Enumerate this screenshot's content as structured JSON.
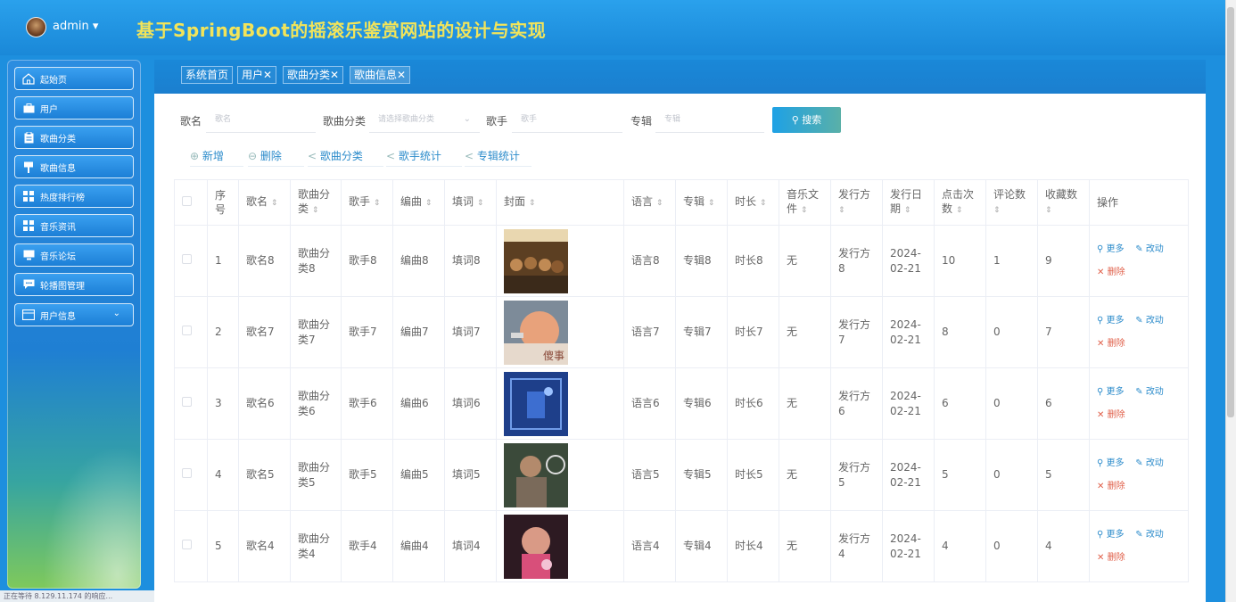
{
  "header": {
    "user": "admin ▾",
    "title": "基于SpringBoot的摇滚乐鉴赏网站的设计与实现"
  },
  "sidebar": {
    "items": [
      {
        "label": "起始页",
        "icon": "home-icon"
      },
      {
        "label": "用户",
        "icon": "briefcase-icon"
      },
      {
        "label": "歌曲分类",
        "icon": "clipboard-icon"
      },
      {
        "label": "歌曲信息",
        "icon": "pin-icon"
      },
      {
        "label": "热度排行榜",
        "icon": "grid-icon"
      },
      {
        "label": "音乐资讯",
        "icon": "grid-icon"
      },
      {
        "label": "音乐论坛",
        "icon": "monitor-icon"
      },
      {
        "label": "轮播图管理",
        "icon": "chat-icon"
      },
      {
        "label": "用户信息",
        "icon": "window-icon",
        "chevron": "⌄"
      }
    ]
  },
  "tabs": [
    {
      "label": "系统首页"
    },
    {
      "label": "用户✕"
    },
    {
      "label": "歌曲分类✕"
    },
    {
      "label": "歌曲信息✕"
    }
  ],
  "filters": {
    "name_label": "歌名",
    "name_placeholder": "歌名",
    "category_label": "歌曲分类",
    "category_placeholder": "请选择歌曲分类",
    "singer_label": "歌手",
    "singer_placeholder": "歌手",
    "album_label": "专辑",
    "album_placeholder": "专辑",
    "search_label": "搜索"
  },
  "toolbar": {
    "add": "新增",
    "delete": "删除",
    "category": "歌曲分类",
    "singer_stats": "歌手统计",
    "album_stats": "专辑统计"
  },
  "table": {
    "headers": [
      "序号",
      "歌名",
      "歌曲分类",
      "歌手",
      "编曲",
      "填词",
      "封面",
      "语言",
      "专辑",
      "时长",
      "音乐文件",
      "发行方",
      "发行日期",
      "点击次数",
      "评论数",
      "收藏数",
      "操作"
    ],
    "op_more": "更多",
    "op_edit": "改动",
    "op_delete": "删除",
    "rows": [
      {
        "idx": "1",
        "name": "歌名8",
        "cat": "歌曲分类8",
        "singer": "歌手8",
        "arr": "编曲8",
        "lyric": "填词8",
        "lang": "语言8",
        "album": "专辑8",
        "dur": "时长8",
        "file": "无",
        "pub": "发行方8",
        "date": "2024-02-21",
        "clicks": "10",
        "comments": "1",
        "favs": "9",
        "cover": "cover-crowd"
      },
      {
        "idx": "2",
        "name": "歌名7",
        "cat": "歌曲分类7",
        "singer": "歌手7",
        "arr": "编曲7",
        "lyric": "填词7",
        "lang": "语言7",
        "album": "专辑7",
        "dur": "时长7",
        "file": "无",
        "pub": "发行方7",
        "date": "2024-02-21",
        "clicks": "8",
        "comments": "0",
        "favs": "7",
        "cover": "cover-sunset",
        "cover_text": "傻事"
      },
      {
        "idx": "3",
        "name": "歌名6",
        "cat": "歌曲分类6",
        "singer": "歌手6",
        "arr": "编曲6",
        "lyric": "填词6",
        "lang": "语言6",
        "album": "专辑6",
        "dur": "时长6",
        "file": "无",
        "pub": "发行方6",
        "date": "2024-02-21",
        "clicks": "6",
        "comments": "0",
        "favs": "6",
        "cover": "cover-blue"
      },
      {
        "idx": "4",
        "name": "歌名5",
        "cat": "歌曲分类5",
        "singer": "歌手5",
        "arr": "编曲5",
        "lyric": "填词5",
        "lang": "语言5",
        "album": "专辑5",
        "dur": "时长5",
        "file": "无",
        "pub": "发行方5",
        "date": "2024-02-21",
        "clicks": "5",
        "comments": "0",
        "favs": "5",
        "cover": "cover-portrait"
      },
      {
        "idx": "5",
        "name": "歌名4",
        "cat": "歌曲分类4",
        "singer": "歌手4",
        "arr": "编曲4",
        "lyric": "填词4",
        "lang": "语言4",
        "album": "专辑4",
        "dur": "时长4",
        "file": "无",
        "pub": "发行方4",
        "date": "2024-02-21",
        "clicks": "4",
        "comments": "0",
        "favs": "4",
        "cover": "cover-pink"
      }
    ]
  },
  "statusbar": "正在等待 8.129.11.174 的响应..."
}
